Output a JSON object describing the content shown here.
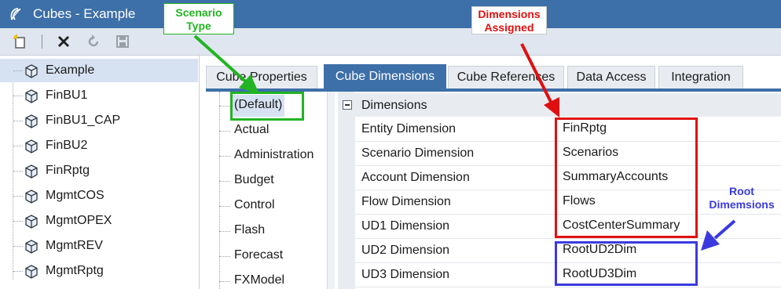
{
  "window": {
    "title": "Cubes - Example"
  },
  "toolbar": {
    "buttons": [
      {
        "icon": "new-item-icon"
      },
      {
        "icon": "delete-icon"
      },
      {
        "icon": "refresh-icon"
      },
      {
        "icon": "save-icon"
      }
    ]
  },
  "tree": {
    "items": [
      {
        "label": "Example",
        "selected": true
      },
      {
        "label": "FinBU1"
      },
      {
        "label": "FinBU1_CAP"
      },
      {
        "label": "FinBU2"
      },
      {
        "label": "FinRptg"
      },
      {
        "label": "MgmtCOS"
      },
      {
        "label": "MgmtOPEX"
      },
      {
        "label": "MgmtREV"
      },
      {
        "label": "MgmtRptg"
      }
    ]
  },
  "tabs": [
    {
      "label": "Cube Properties"
    },
    {
      "label": "Cube Dimensions",
      "active": true
    },
    {
      "label": "Cube References"
    },
    {
      "label": "Data Access"
    },
    {
      "label": "Integration"
    }
  ],
  "scenario_types": [
    {
      "label": "(Default)",
      "selected": true
    },
    {
      "label": "Actual"
    },
    {
      "label": "Administration"
    },
    {
      "label": "Budget"
    },
    {
      "label": "Control"
    },
    {
      "label": "Flash"
    },
    {
      "label": "Forecast"
    },
    {
      "label": "FXModel"
    }
  ],
  "grid": {
    "category": "Dimensions",
    "properties": [
      {
        "name": "Entity Dimension",
        "value": "FinRptg"
      },
      {
        "name": "Scenario Dimension",
        "value": "Scenarios"
      },
      {
        "name": "Account Dimension",
        "value": "SummaryAccounts"
      },
      {
        "name": "Flow Dimension",
        "value": "Flows"
      },
      {
        "name": "UD1 Dimension",
        "value": "CostCenterSummary"
      },
      {
        "name": "UD2 Dimension",
        "value": "RootUD2Dim"
      },
      {
        "name": "UD3 Dimension",
        "value": "RootUD3Dim"
      }
    ]
  },
  "annotations": {
    "scenario_type": {
      "text": "Scenario Type",
      "color": "#22b422"
    },
    "dimensions_assigned": {
      "text": "Dimensions Assigned",
      "color": "#e01010"
    },
    "root_dimensions": {
      "text": "Root Dimemsions",
      "color": "#3a3ae0"
    }
  },
  "colors": {
    "accent": "#3d6fa8",
    "selection": "#d6e2f2",
    "annotation_green": "#22b422",
    "annotation_red": "#e01010",
    "annotation_blue": "#3a3ae0"
  }
}
